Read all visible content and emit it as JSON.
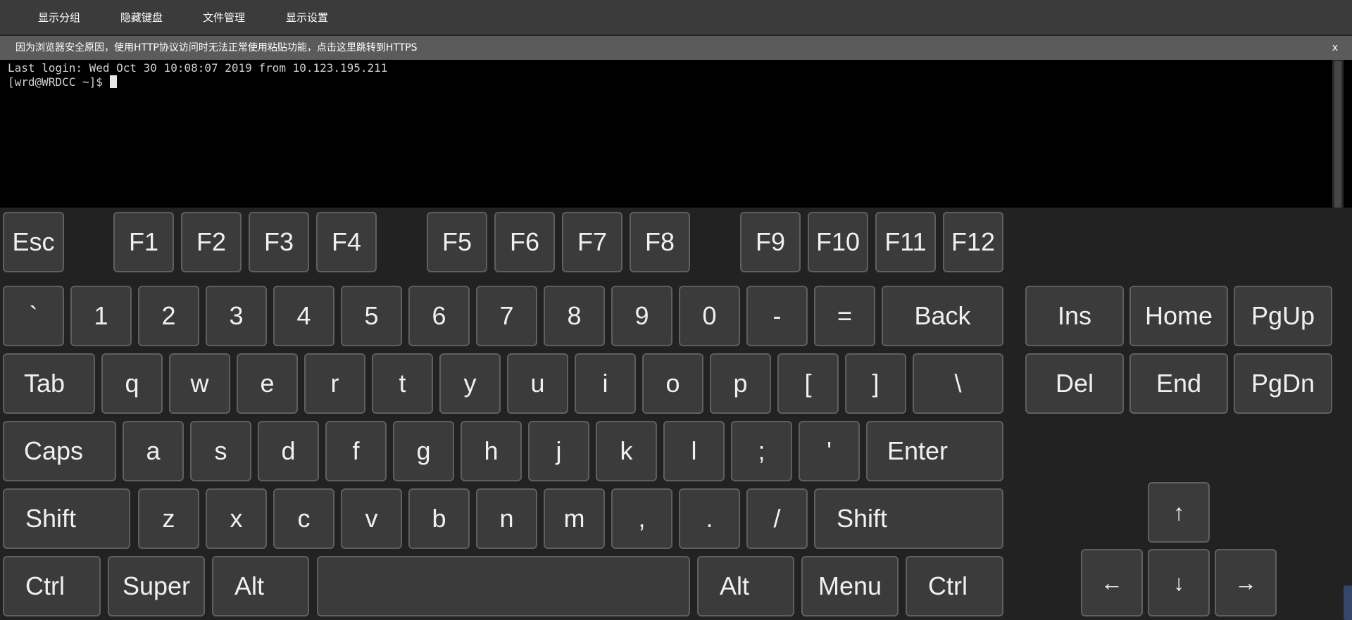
{
  "menu": {
    "items": [
      "显示分组",
      "隐藏键盘",
      "文件管理",
      "显示设置"
    ]
  },
  "notice": {
    "text": "因为浏览器安全原因，使用HTTP协议访问时无法正常使用粘贴功能，点击这里跳转到HTTPS",
    "close": "x"
  },
  "terminal": {
    "last_login": "Last login: Wed Oct 30 10:08:07 2019 from 10.123.195.211",
    "prompt": "[wrd@WRDCC ~]$ "
  },
  "keyboard": {
    "function_row": [
      "Esc",
      "F1",
      "F2",
      "F3",
      "F4",
      "F5",
      "F6",
      "F7",
      "F8",
      "F9",
      "F10",
      "F11",
      "F12"
    ],
    "number_row": [
      "`",
      "1",
      "2",
      "3",
      "4",
      "5",
      "6",
      "7",
      "8",
      "9",
      "0",
      "-",
      "=",
      "Back"
    ],
    "top_row": [
      "Tab",
      "q",
      "w",
      "e",
      "r",
      "t",
      "y",
      "u",
      "i",
      "o",
      "p",
      "[",
      "]",
      "\\"
    ],
    "home_row": [
      "Caps",
      "a",
      "s",
      "d",
      "f",
      "g",
      "h",
      "j",
      "k",
      "l",
      ";",
      "'",
      "Enter"
    ],
    "bottom_row": [
      "Shift",
      "z",
      "x",
      "c",
      "v",
      "b",
      "n",
      "m",
      ",",
      ".",
      "/",
      "Shift"
    ],
    "space_row": [
      "Ctrl",
      "Super",
      "Alt",
      "",
      "Alt",
      "Menu",
      "Ctrl"
    ],
    "nav_top": [
      "Ins",
      "Home",
      "PgUp"
    ],
    "nav_bottom": [
      "Del",
      "End",
      "PgDn"
    ],
    "arrows": {
      "up": "↑",
      "left": "←",
      "down": "↓",
      "right": "→"
    }
  },
  "colors": {
    "menubar": "#3b3b3b",
    "notice": "#5b5b5b",
    "terminal_bg": "#000000",
    "key_bg": "#3b3b3b",
    "key_border": "#5f5f5f",
    "keyboard_bg": "#222222"
  }
}
